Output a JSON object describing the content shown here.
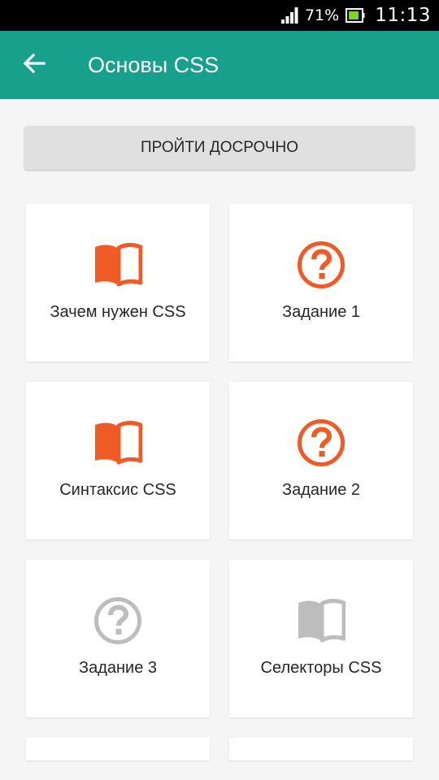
{
  "status_bar": {
    "battery_percent": "71%",
    "time": "11:13",
    "icons": [
      "signal-icon",
      "battery-icon"
    ]
  },
  "app_bar": {
    "back_icon": "arrow-left-icon",
    "title": "Основы CSS",
    "background_color": "#17a18c"
  },
  "skip_button": {
    "label": "ПРОЙТИ ДОСРОЧНО"
  },
  "colors": {
    "active_icon": "#f05a24",
    "locked_icon": "#bdbdbd"
  },
  "lessons": [
    {
      "label": "Зачем нужен CSS",
      "icon": "book-icon",
      "state": "active"
    },
    {
      "label": "Задание 1",
      "icon": "question-icon",
      "state": "active"
    },
    {
      "label": "Синтаксис CSS",
      "icon": "book-icon",
      "state": "active"
    },
    {
      "label": "Задание 2",
      "icon": "question-icon",
      "state": "active"
    },
    {
      "label": "Задание 3",
      "icon": "question-icon",
      "state": "locked"
    },
    {
      "label": "Селекторы CSS",
      "icon": "book-icon",
      "state": "locked"
    }
  ]
}
